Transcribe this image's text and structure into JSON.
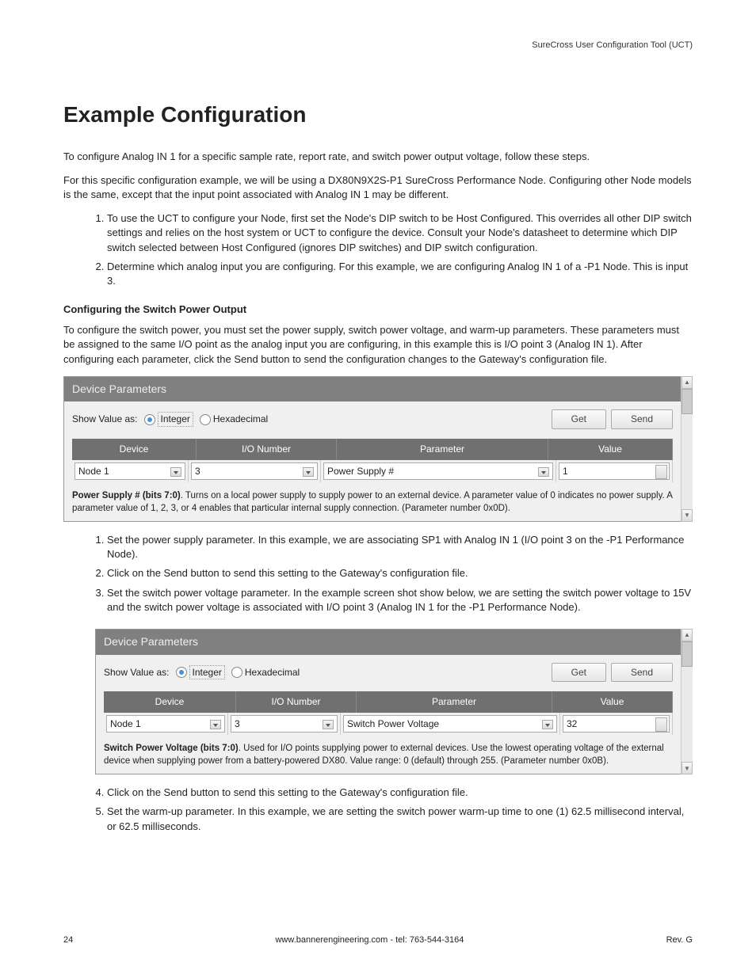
{
  "header": {
    "product": "SureCross User Configuration Tool (UCT)"
  },
  "title": "Example Configuration",
  "intro1": "To configure Analog IN 1 for a specific sample rate, report rate, and switch power output voltage, follow these steps.",
  "intro2": "For this specific configuration example, we will be using a DX80N9X2S-P1 SureCross Performance Node. Configuring other Node models is the same, except that the input point associated with Analog IN 1 may be different.",
  "steps_a": [
    "To use the UCT to configure your Node, first set the Node's DIP switch to be Host Configured. This overrides all other DIP switch settings and relies on the host system or UCT to configure the device. Consult your Node's datasheet to determine which DIP switch selected between Host Configured (ignores DIP switches) and DIP switch configuration.",
    "Determine which analog input you are configuring. For this example, we are configuring Analog IN 1 of a -P1 Node. This is input 3."
  ],
  "subhead": "Configuring the Switch Power Output",
  "sub_intro": "To configure the switch power, you must set the power supply, switch power voltage, and warm-up parameters. These parameters must be assigned to the same I/O point as the analog input you are configuring, in this example this is I/O point 3 (Analog IN 1). After configuring each parameter, click the Send button to send the configuration changes to the Gateway's configuration file.",
  "panel": {
    "title": "Device Parameters",
    "show_label": "Show Value as:",
    "radio_int": "Integer",
    "radio_hex": "Hexadecimal",
    "btn_get": "Get",
    "btn_send": "Send",
    "col_device": "Device",
    "col_io": "I/O Number",
    "col_param": "Parameter",
    "col_value": "Value"
  },
  "panel1": {
    "device": "Node 1",
    "io": "3",
    "param": "Power Supply #",
    "value": "1",
    "desc_b": "Power Supply # (bits 7:0)",
    "desc": ". Turns on a local power supply to supply power to an external device. A parameter value of 0 indicates no power supply. A parameter value of 1, 2, 3, or 4 enables that particular internal supply connection. (Parameter number 0x0D)."
  },
  "steps_b": [
    "Set the power supply parameter. In this example, we are associating SP1 with Analog IN 1 (I/O point 3 on the -P1 Performance Node).",
    "Click on the Send button to send this setting to the Gateway's configuration file.",
    "Set the switch power voltage parameter. In the example screen shot show below, we are setting the switch power voltage to 15V and the switch power voltage is associated with I/O point 3 (Analog IN 1 for the -P1 Performance Node)."
  ],
  "panel2": {
    "device": "Node 1",
    "io": "3",
    "param": "Switch Power Voltage",
    "value": "32",
    "desc_b": "Switch Power Voltage (bits 7:0)",
    "desc": ". Used for I/O points supplying power to external devices. Use the lowest operating voltage of the external device when supplying power from a battery-powered DX80. Value range: 0 (default) through 255. (Parameter number 0x0B)."
  },
  "steps_c": [
    "Click on the Send button to send this setting to the Gateway's configuration file.",
    "Set the warm-up parameter. In this example, we are setting the switch power warm-up time to one (1) 62.5 millisecond interval, or 62.5 milliseconds."
  ],
  "footer": {
    "page": "24",
    "center": "www.bannerengineering.com - tel: 763-544-3164",
    "rev": "Rev. G"
  }
}
